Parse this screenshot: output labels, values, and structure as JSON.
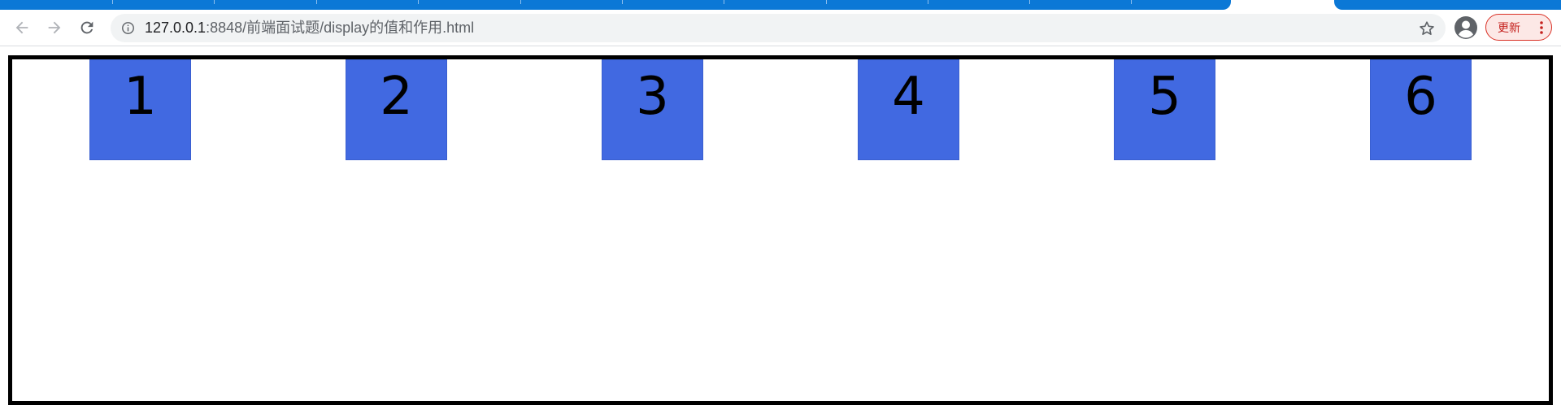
{
  "browser": {
    "url_host": "127.0.0.1",
    "url_path": ":8848/前端面试题/display的值和作用.html",
    "update_label": "更新"
  },
  "icons": {
    "back": "back-arrow-icon",
    "forward": "forward-arrow-icon",
    "reload": "reload-icon",
    "info": "info-icon",
    "star": "star-icon",
    "avatar": "avatar-icon",
    "menu": "more-vert-icon"
  },
  "colors": {
    "tab_blue": "#0b78d6",
    "box_blue": "#4169e1",
    "update_red": "#d93025"
  },
  "page": {
    "boxes": [
      {
        "label": "1"
      },
      {
        "label": "2"
      },
      {
        "label": "3"
      },
      {
        "label": "4"
      },
      {
        "label": "5"
      },
      {
        "label": "6"
      }
    ]
  }
}
